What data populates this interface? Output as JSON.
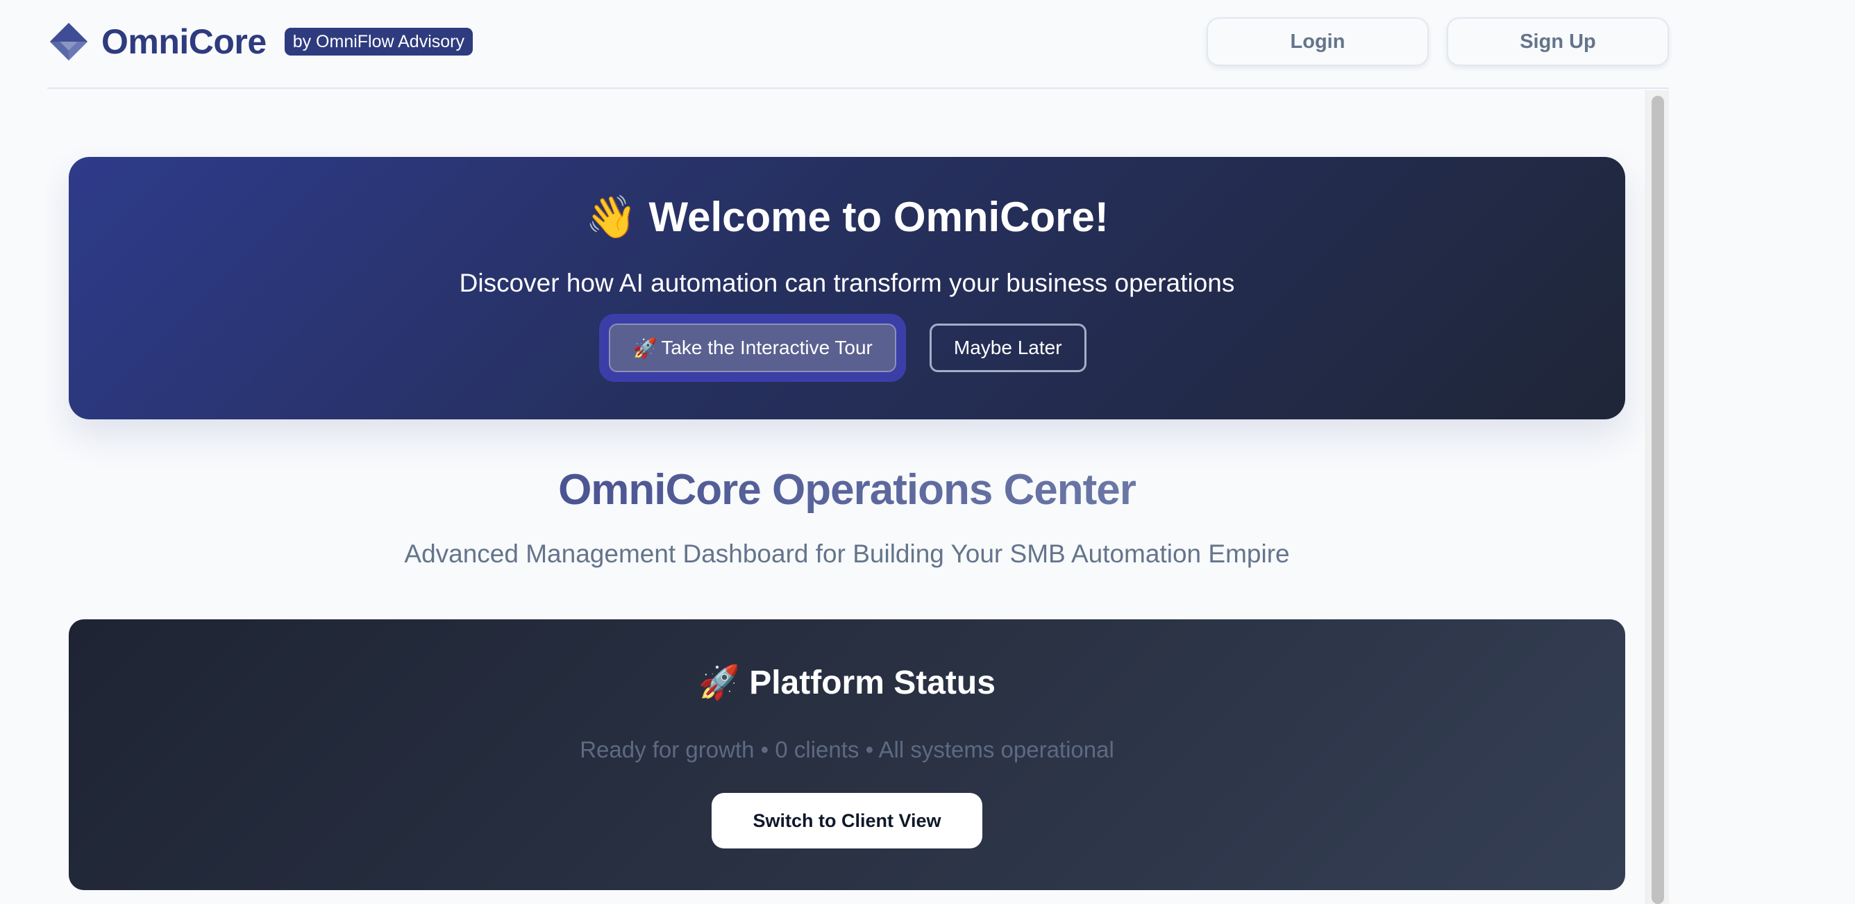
{
  "header": {
    "brand_name": "OmniCore",
    "brand_badge": "by OmniFlow Advisory",
    "login_label": "Login",
    "signup_label": "Sign Up",
    "logo_icon": "diamond-logo-icon"
  },
  "welcome": {
    "title_emoji": "👋",
    "title": "Welcome to OmniCore!",
    "subtitle": "Discover how AI automation can transform your business operations",
    "tour_emoji": "🚀",
    "tour_label": "Take the Interactive Tour",
    "later_label": "Maybe Later"
  },
  "ops": {
    "title": "OmniCore Operations Center",
    "subtitle": "Advanced Management Dashboard for Building Your SMB Automation Empire"
  },
  "status": {
    "title_emoji": "🚀",
    "title": "Platform Status",
    "summary": "Ready for growth • 0 clients • All systems operational",
    "switch_label": "Switch to Client View"
  },
  "colors": {
    "brand": "#2e3b7e",
    "page_bg": "#f8fafc",
    "welcome_gradient_start": "#2e3b8a",
    "welcome_gradient_end": "#1f2638",
    "status_gradient_start": "#1e2433",
    "status_gradient_end": "#353f54",
    "tour_glow": "#3c3ea8"
  }
}
